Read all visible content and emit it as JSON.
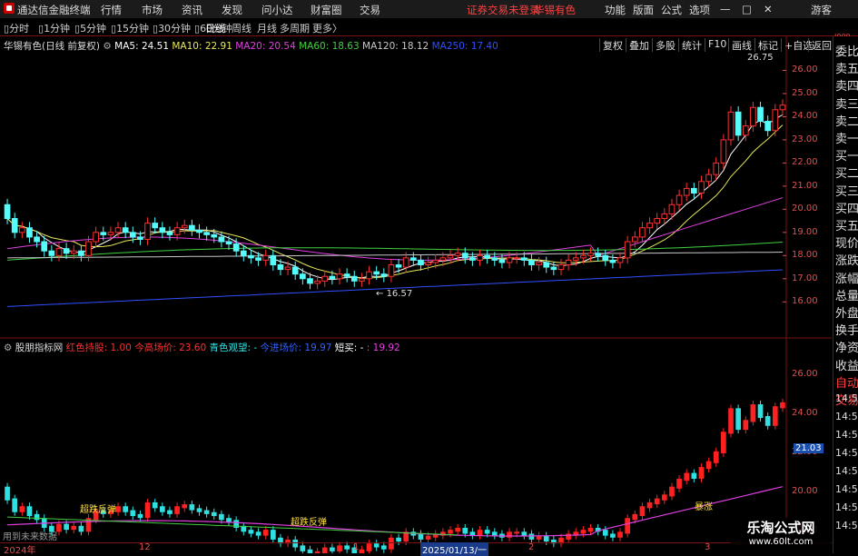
{
  "app": {
    "title": "通达信金融终端",
    "menu": [
      "行情",
      "市场",
      "资讯",
      "发现",
      "问小达",
      "财富圈",
      "交易"
    ],
    "status_left": "证券交易未登录",
    "status_right": "华锡有色",
    "right_menu": [
      "功能",
      "版面",
      "公式",
      "选项"
    ],
    "guest": "游客"
  },
  "toolbar": {
    "periods": [
      "分时",
      "1分钟",
      "5分钟",
      "15分钟",
      "30分钟",
      "60分钟",
      "日线",
      "周线",
      "月线",
      "多周期",
      "更多"
    ],
    "active_period": "日线",
    "right_buttons": [
      "复权",
      "叠加",
      "多股",
      "统计",
      "F10",
      "画线",
      "标记",
      "+自选",
      "返回"
    ]
  },
  "main_chart": {
    "stock_label": "华锡有色(日线 前复权)",
    "ma": [
      {
        "label": "MA5: 24.51",
        "color": "#ffffff"
      },
      {
        "label": "MA10: 22.91",
        "color": "#e8e85a"
      },
      {
        "label": "MA20: 20.54",
        "color": "#e040e0"
      },
      {
        "label": "MA60: 18.63",
        "color": "#40d040"
      },
      {
        "label": "MA120: 18.12",
        "color": "#c8c8c8"
      },
      {
        "label": "MA250: 17.40",
        "color": "#3050ff"
      }
    ],
    "high_marker": "26.75",
    "low_marker": "16.57",
    "y_ticks": [
      "26.00",
      "25.00",
      "24.00",
      "23.00",
      "22.00",
      "21.00",
      "20.00",
      "19.00",
      "18.00",
      "17.00",
      "16.00"
    ],
    "corner_mark": "I000"
  },
  "indicator": {
    "name": "股朋指标网",
    "items": [
      {
        "label": "红色持股: 1.00",
        "color": "#ff3030"
      },
      {
        "label": "今高场价: 23.60",
        "color": "#ff3030"
      },
      {
        "label": "青色观望: -",
        "color": "#30e0e0"
      },
      {
        "label": "今进场价: 19.97",
        "color": "#3060ff"
      },
      {
        "label": "短买: -",
        "color": "#ffffff"
      },
      {
        "label": ": 19.92",
        "color": "#e040e0"
      }
    ],
    "y_ticks": [
      "26.00",
      "24.00",
      "22.00",
      "20.00",
      "18.00"
    ],
    "current_price": "21.03",
    "annotations": [
      "超跌反弹",
      "超跌反弹",
      "暴涨"
    ],
    "footer": "用到未来数据"
  },
  "x_axis": [
    "2024年",
    "12",
    "1",
    "2025/01/13/一",
    "2",
    "3"
  ],
  "right_panel": {
    "labels": [
      "委比",
      "卖五",
      "卖四",
      "卖三",
      "卖二",
      "卖一",
      "买一",
      "买二",
      "买三",
      "买四",
      "买五",
      "现价",
      "涨跌",
      "涨幅",
      "总量",
      "外盘",
      "换手",
      "净资",
      "收益",
      "自动",
      "交易"
    ],
    "times": [
      "14:56",
      "14:56",
      "14:56",
      "14:56",
      "14:56",
      "14:56",
      "14:56",
      "14:56"
    ]
  },
  "watermark": {
    "title": "乐淘公式网",
    "url": "www.60lt.com"
  },
  "chart_data": {
    "type": "candlestick",
    "x": [
      0,
      1,
      2,
      3,
      4,
      5,
      6,
      7,
      8,
      9,
      10,
      11,
      12,
      13,
      14,
      15,
      16,
      17,
      18,
      19,
      20,
      21,
      22,
      23,
      24,
      25,
      26,
      27,
      28,
      29,
      30,
      31,
      32,
      33,
      34,
      35,
      36,
      37,
      38,
      39,
      40,
      41,
      42,
      43,
      44,
      45,
      46,
      47,
      48,
      49,
      50,
      51,
      52,
      53,
      54,
      55,
      56,
      57,
      58,
      59,
      60,
      61,
      62,
      63,
      64,
      65,
      66,
      67,
      68,
      69,
      70,
      71,
      72,
      73,
      74,
      75,
      76,
      77,
      78,
      79,
      80,
      81,
      82,
      83,
      84,
      85,
      86,
      87,
      88,
      89,
      90,
      91,
      92,
      93,
      94,
      95,
      96,
      97,
      98,
      99,
      100,
      101,
      102,
      103,
      104,
      105
    ],
    "open": [
      20.2,
      19.6,
      19.0,
      19.2,
      18.8,
      18.6,
      18.2,
      18.0,
      18.3,
      18.1,
      18.2,
      18.0,
      18.6,
      19.0,
      18.9,
      19.0,
      19.2,
      19.0,
      18.8,
      18.7,
      19.4,
      19.2,
      19.0,
      18.9,
      19.2,
      19.3,
      19.1,
      19.0,
      18.9,
      18.8,
      18.6,
      18.5,
      18.2,
      18.0,
      17.9,
      17.8,
      18.0,
      17.6,
      17.4,
      17.5,
      17.2,
      17.0,
      16.8,
      16.9,
      17.1,
      17.0,
      17.2,
      17.1,
      16.9,
      17.0,
      17.3,
      17.2,
      17.1,
      17.6,
      17.5,
      17.9,
      17.8,
      17.6,
      17.7,
      17.8,
      17.9,
      18.0,
      18.1,
      17.9,
      17.8,
      18.0,
      17.9,
      17.8,
      17.7,
      17.9,
      17.9,
      17.8,
      17.6,
      17.7,
      17.5,
      17.4,
      17.6,
      17.8,
      17.9,
      18.0,
      18.1,
      18.0,
      17.8,
      17.7,
      17.9,
      18.6,
      18.8,
      19.2,
      19.4,
      19.6,
      19.8,
      20.2,
      20.6,
      20.9,
      20.7,
      21.2,
      21.5,
      22.0,
      23.0,
      24.2,
      23.2,
      23.6,
      24.4,
      23.8,
      23.4,
      24.3
    ],
    "close": [
      19.6,
      19.0,
      19.2,
      18.8,
      18.6,
      18.2,
      18.0,
      18.3,
      18.1,
      18.2,
      18.0,
      18.6,
      19.0,
      18.9,
      19.0,
      19.2,
      19.0,
      18.8,
      18.7,
      19.4,
      19.2,
      19.0,
      18.9,
      19.2,
      19.3,
      19.1,
      19.0,
      18.9,
      18.8,
      18.6,
      18.5,
      18.2,
      18.0,
      17.9,
      17.8,
      18.0,
      17.6,
      17.4,
      17.5,
      17.2,
      17.0,
      16.8,
      16.9,
      17.1,
      17.0,
      17.2,
      17.1,
      16.9,
      17.0,
      17.3,
      17.2,
      17.1,
      17.6,
      17.5,
      17.9,
      17.8,
      17.6,
      17.7,
      17.8,
      17.9,
      18.0,
      18.1,
      17.9,
      17.8,
      18.0,
      17.9,
      17.8,
      17.7,
      17.9,
      17.9,
      17.8,
      17.6,
      17.7,
      17.5,
      17.4,
      17.6,
      17.8,
      17.9,
      18.0,
      18.1,
      18.0,
      17.8,
      17.7,
      17.9,
      18.6,
      18.8,
      19.2,
      19.4,
      19.6,
      19.8,
      20.2,
      20.6,
      20.9,
      20.7,
      21.2,
      21.5,
      22.0,
      23.0,
      24.2,
      23.2,
      23.6,
      24.4,
      23.8,
      23.4,
      24.3,
      24.5
    ]
  }
}
